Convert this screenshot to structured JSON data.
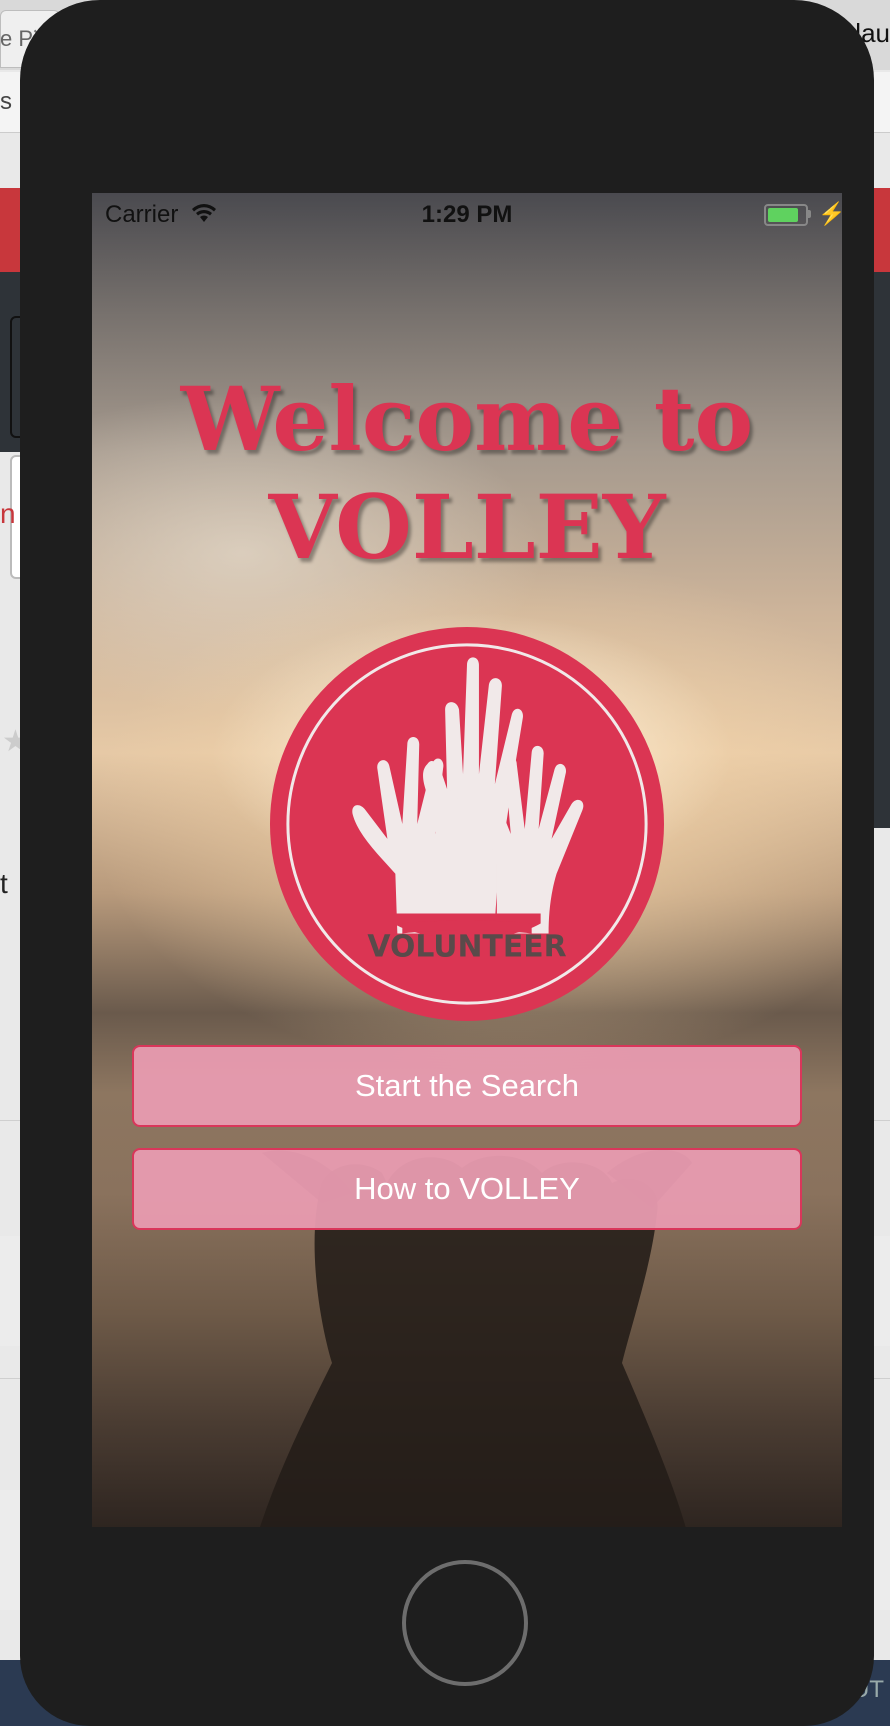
{
  "background": {
    "tab_text": "e P",
    "tab_close": "✕",
    "top_right_text": "lau",
    "address_text": "s",
    "red_letter": "n",
    "side_text": "t",
    "bottom_text": "UT"
  },
  "status_bar": {
    "carrier": "Carrier",
    "time": "1:29 PM"
  },
  "welcome": {
    "line1": "Welcome to",
    "line2": "VOLLEY"
  },
  "logo": {
    "text": "VOLUNTEER"
  },
  "buttons": {
    "start_search": "Start the Search",
    "how_to": "How to VOLLEY"
  },
  "colors": {
    "brand": "#db3553",
    "button_fill": "#e89bb0"
  }
}
